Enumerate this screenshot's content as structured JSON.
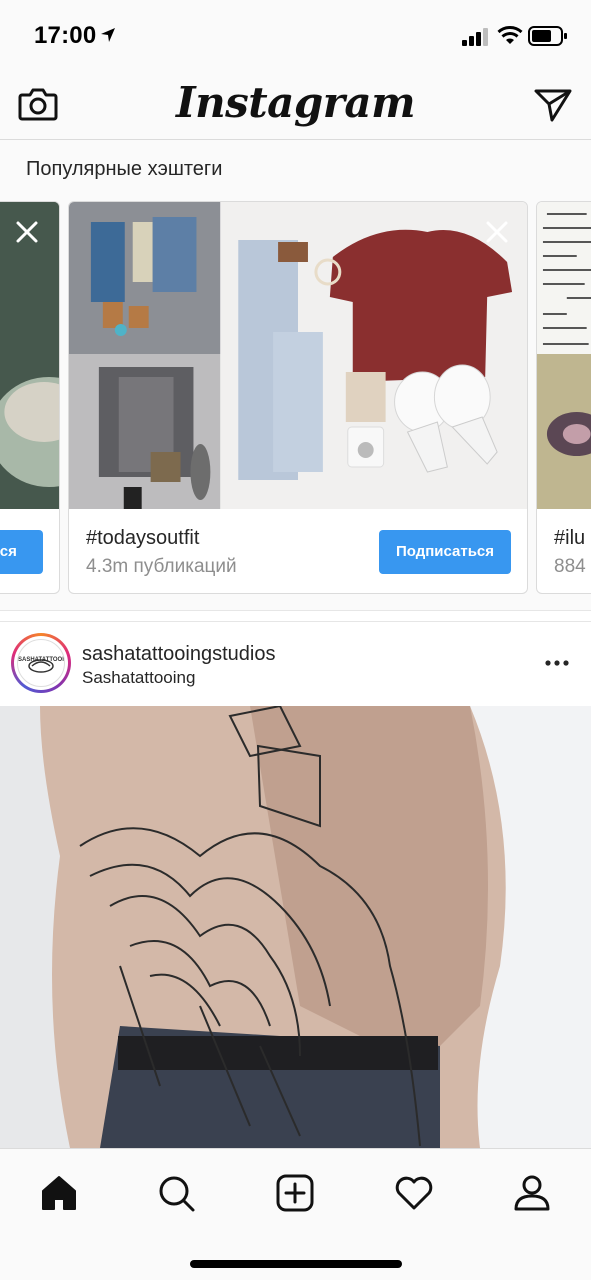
{
  "status_bar": {
    "time": "17:00"
  },
  "nav": {
    "logo_text": "Instagram"
  },
  "suggested": {
    "title": "Популярные хэштеги",
    "cards": [
      {
        "name": "",
        "count": "",
        "follow_label": "ться"
      },
      {
        "name": "#todaysoutfit",
        "count": "4.3m публикаций",
        "follow_label": "Подписаться"
      },
      {
        "name": "#ilu",
        "count": "884"
      }
    ]
  },
  "post": {
    "username": "sashatattooingstudios",
    "sublabel": "Sashatattooing",
    "avatar_text": "SASHATATTOOING"
  },
  "tab_bar": {
    "tabs": [
      "home-icon",
      "search-icon",
      "add-post-icon",
      "activity-heart-icon",
      "profile-icon"
    ]
  },
  "colors": {
    "accent": "#3897f0",
    "text": "#262626",
    "muted": "#8e8e8e"
  }
}
